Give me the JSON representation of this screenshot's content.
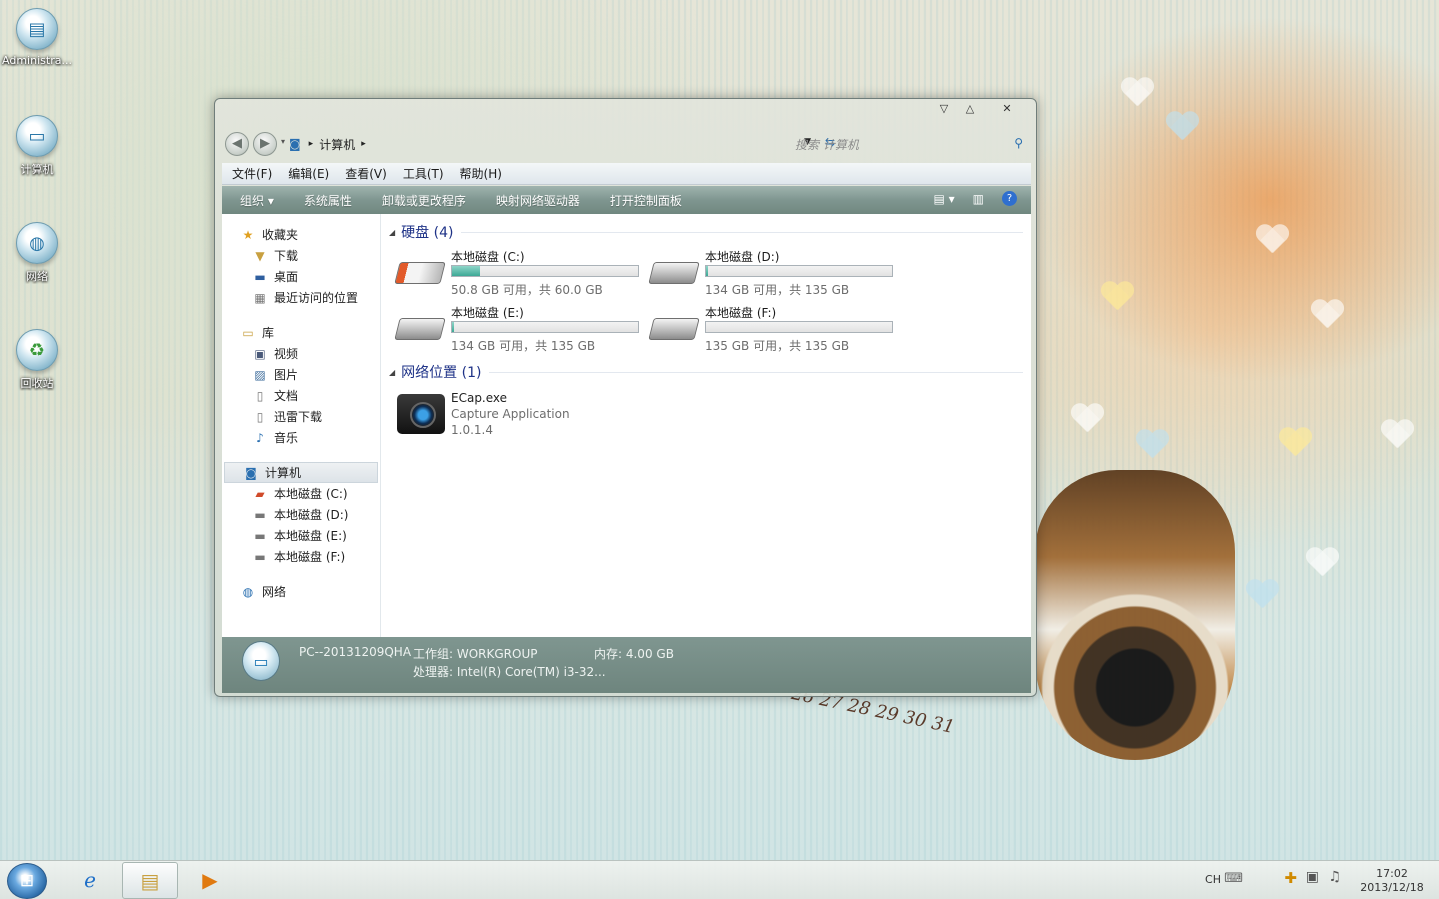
{
  "desktop": {
    "icons": [
      {
        "label": "Administra...",
        "icon": "user-folder-icon"
      },
      {
        "label": "计算机",
        "icon": "computer-icon"
      },
      {
        "label": "网络",
        "icon": "network-globe-icon"
      },
      {
        "label": "回收站",
        "icon": "recycle-bin-icon"
      }
    ],
    "wallpaper_numbers": "26 27 28 29 30 31"
  },
  "window": {
    "controls": {
      "minimize": "▽",
      "maximize": "△",
      "close": "✕"
    },
    "address": {
      "icon": "computer-small-icon",
      "path": "计算机"
    },
    "search": {
      "placeholder": "搜索 计算机"
    },
    "menu": [
      "文件(F)",
      "编辑(E)",
      "查看(V)",
      "工具(T)",
      "帮助(H)"
    ],
    "commands": {
      "organize": "组织",
      "items": [
        "系统属性",
        "卸载或更改程序",
        "映射网络驱动器",
        "打开控制面板"
      ]
    },
    "nav": {
      "favorites": {
        "label": "收藏夹",
        "items": [
          "下载",
          "桌面",
          "最近访问的位置"
        ]
      },
      "libraries": {
        "label": "库",
        "items": [
          "视频",
          "图片",
          "文档",
          "迅雷下载",
          "音乐"
        ]
      },
      "computer": {
        "label": "计算机",
        "items": [
          "本地磁盘 (C:)",
          "本地磁盘 (D:)",
          "本地磁盘 (E:)",
          "本地磁盘 (F:)"
        ]
      },
      "network": {
        "label": "网络"
      }
    },
    "groups": {
      "drives": {
        "title": "硬盘 (4)",
        "items": [
          {
            "name": "本地磁盘 (C:)",
            "free": "50.8 GB 可用，共 60.0 GB",
            "used_fraction": 0.15,
            "system": true
          },
          {
            "name": "本地磁盘 (D:)",
            "free": "134 GB 可用，共 135 GB",
            "used_fraction": 0.01,
            "system": false
          },
          {
            "name": "本地磁盘 (E:)",
            "free": "134 GB 可用，共 135 GB",
            "used_fraction": 0.01,
            "system": false
          },
          {
            "name": "本地磁盘 (F:)",
            "free": "135 GB 可用，共 135 GB",
            "used_fraction": 0.0,
            "system": false
          }
        ]
      },
      "network": {
        "title": "网络位置 (1)",
        "items": [
          {
            "name": "ECap.exe",
            "description": "Capture Application",
            "version": "1.0.1.4"
          }
        ]
      }
    },
    "details": {
      "computer_name": "PC--20131209QHA",
      "workgroup": "工作组: WORKGROUP",
      "memory": "内存: 4.00 GB",
      "processor": "处理器: Intel(R) Core(TM) i3-32..."
    }
  },
  "taskbar": {
    "apps": [
      {
        "name": "internet-explorer",
        "active": false
      },
      {
        "name": "windows-explorer",
        "active": true
      },
      {
        "name": "media-player",
        "active": false
      }
    ],
    "tray": {
      "language": "CH",
      "time": "17:02",
      "date": "2013/12/18"
    }
  },
  "colors": {
    "command_bar": "#7f9690",
    "group_title": "#1e3287",
    "disk_bar_fill": "#3da895"
  }
}
